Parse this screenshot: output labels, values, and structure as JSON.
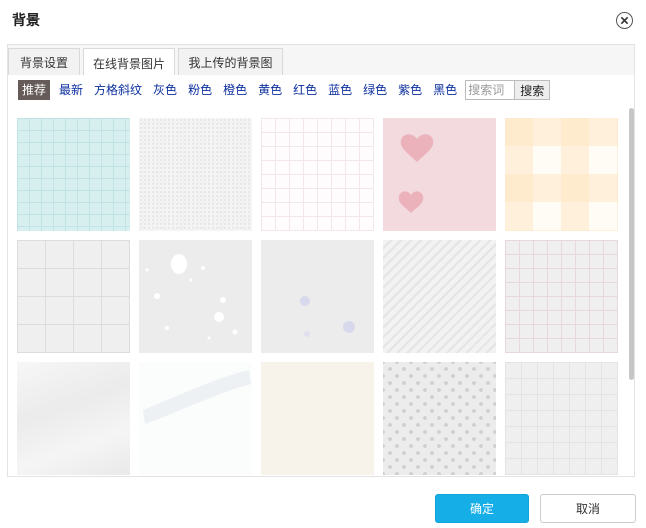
{
  "dialog": {
    "title": "背景",
    "ok_label": "确定",
    "cancel_label": "取消"
  },
  "tabs": [
    {
      "label": "背景设置",
      "active": false
    },
    {
      "label": "在线背景图片",
      "active": true
    },
    {
      "label": "我上传的背景图",
      "active": false
    }
  ],
  "filters": [
    {
      "label": "推荐",
      "active": true
    },
    {
      "label": "最新"
    },
    {
      "label": "方格斜纹"
    },
    {
      "label": "灰色"
    },
    {
      "label": "粉色"
    },
    {
      "label": "橙色"
    },
    {
      "label": "黄色"
    },
    {
      "label": "红色"
    },
    {
      "label": "蓝色"
    },
    {
      "label": "绿色"
    },
    {
      "label": "紫色"
    },
    {
      "label": "黑色"
    }
  ],
  "search": {
    "placeholder": "搜索词",
    "button_label": "搜索"
  },
  "colors": {
    "accent": "#16aee6",
    "filter_active_bg": "#655c59",
    "filter_link": "#0b2f9e"
  },
  "backgrounds": [
    {
      "pattern": "light-cyan-grid"
    },
    {
      "pattern": "white-paper-texture"
    },
    {
      "pattern": "faint-pink-grid"
    },
    {
      "pattern": "pink-hearts"
    },
    {
      "pattern": "peach-plaid"
    },
    {
      "pattern": "gray-dotted-grid"
    },
    {
      "pattern": "gray-splatter"
    },
    {
      "pattern": "gray-bubbles"
    },
    {
      "pattern": "gray-diagonal-stripes"
    },
    {
      "pattern": "gray-pink-grid"
    },
    {
      "pattern": "white-crumpled-paper"
    },
    {
      "pattern": "white-watercolor-stroke"
    },
    {
      "pattern": "cream-paper"
    },
    {
      "pattern": "gray-polka-dots"
    },
    {
      "pattern": "light-gray-grid"
    }
  ]
}
